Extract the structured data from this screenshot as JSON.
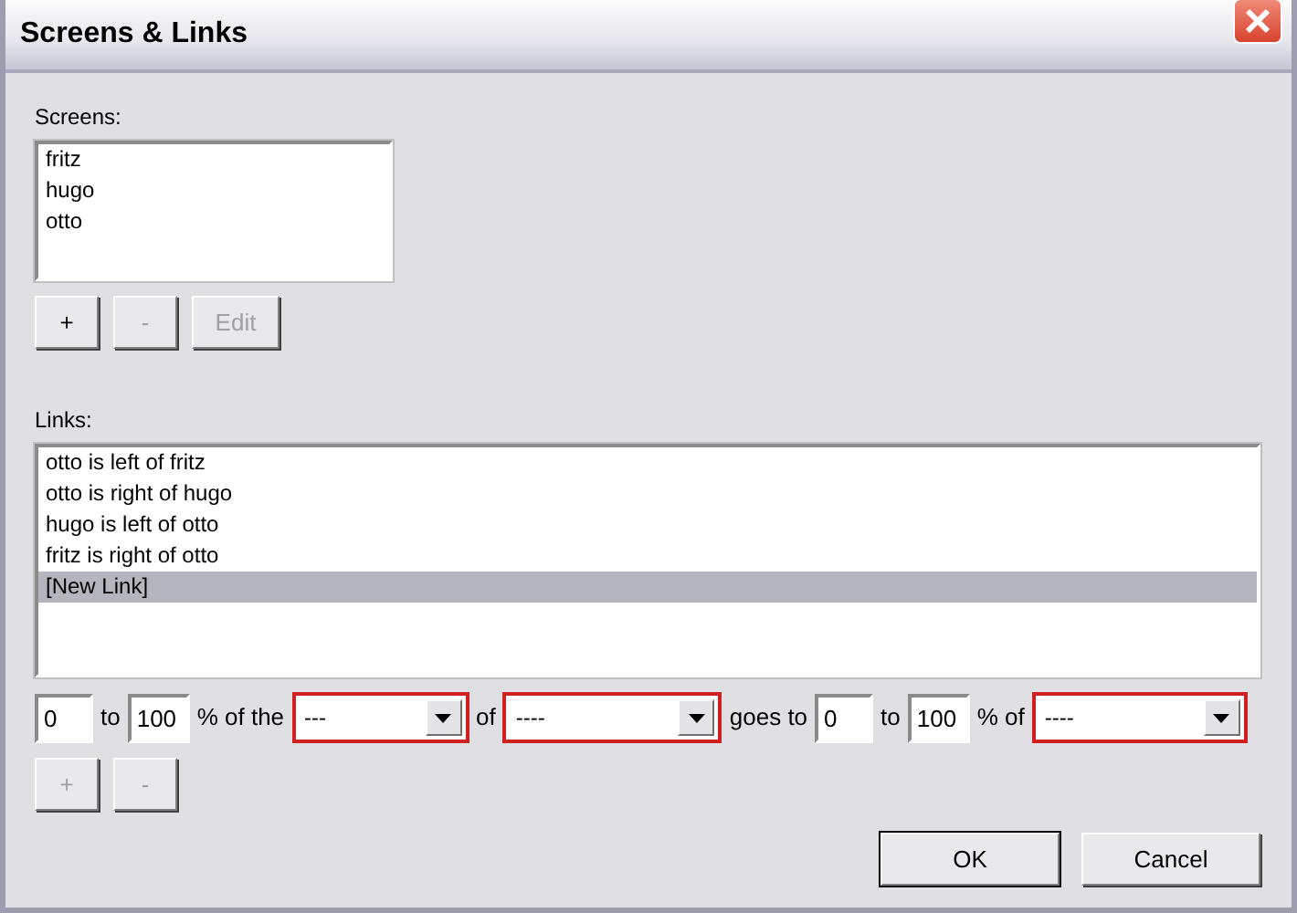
{
  "window": {
    "title": "Screens & Links"
  },
  "screens": {
    "label": "Screens:",
    "items": [
      {
        "text": "fritz"
      },
      {
        "text": "hugo"
      },
      {
        "text": "otto"
      }
    ],
    "buttons": [
      {
        "label": "+",
        "disabled": false
      },
      {
        "label": "-",
        "disabled": true
      },
      {
        "label": "Edit",
        "disabled": true
      }
    ]
  },
  "links": {
    "label": "Links:",
    "items": [
      {
        "text": "otto is left of fritz",
        "selected": false
      },
      {
        "text": "otto is right of hugo",
        "selected": false
      },
      {
        "text": "hugo is left of otto",
        "selected": false
      },
      {
        "text": "fritz is right of otto",
        "selected": false
      },
      {
        "text": "[New Link]",
        "selected": true
      }
    ],
    "rule": [
      {
        "kind": "field",
        "value": "0"
      },
      {
        "kind": "text",
        "text": "to"
      },
      {
        "kind": "field",
        "value": "100"
      },
      {
        "kind": "text",
        "text": "% of the"
      },
      {
        "kind": "dropdown",
        "value": "---",
        "invalid": true
      },
      {
        "kind": "text",
        "text": "of"
      },
      {
        "kind": "dropdown",
        "value": "----",
        "invalid": true
      },
      {
        "kind": "text",
        "text": "goes to"
      },
      {
        "kind": "field",
        "value": "0"
      },
      {
        "kind": "text",
        "text": "to"
      },
      {
        "kind": "field",
        "value": "100"
      },
      {
        "kind": "text",
        "text": "% of"
      },
      {
        "kind": "dropdown",
        "value": "----",
        "invalid": true
      }
    ],
    "buttons": [
      {
        "label": "+",
        "disabled": true
      },
      {
        "label": "-",
        "disabled": true
      }
    ]
  },
  "footer": [
    {
      "label": "OK",
      "default": true
    },
    {
      "label": "Cancel",
      "default": false
    }
  ]
}
